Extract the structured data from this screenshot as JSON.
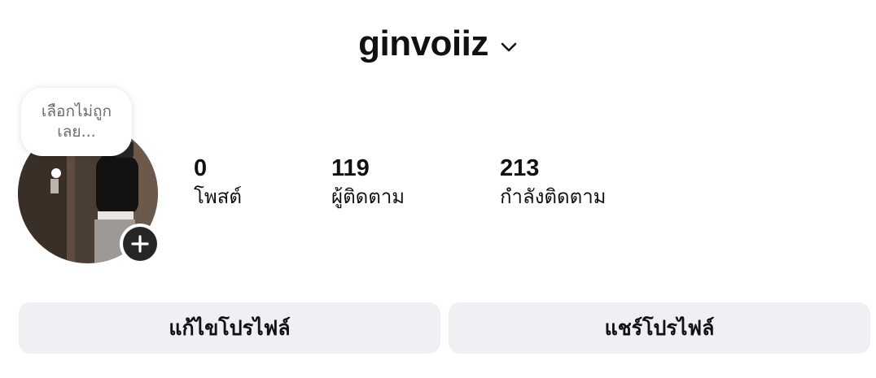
{
  "header": {
    "username": "ginvoiiz",
    "dropdown_icon": "chevron-down-icon"
  },
  "note_bubble": {
    "text": "เลือกไม่ถูกเลย..."
  },
  "stats": {
    "posts": {
      "value": "0",
      "label": "โพสต์"
    },
    "followers": {
      "value": "119",
      "label": "ผู้ติดตาม"
    },
    "following": {
      "value": "213",
      "label": "กำลังติดตาม"
    }
  },
  "avatar": {
    "add_icon": "plus-icon"
  },
  "buttons": {
    "edit_profile": "แก้ไขโปรไฟล์",
    "share_profile": "แชร์โปรไฟล์"
  },
  "colors": {
    "button_bg": "#eff0f3",
    "badge_bg": "#262626",
    "text": "#111111",
    "bubble_text": "#6b6b6b"
  }
}
